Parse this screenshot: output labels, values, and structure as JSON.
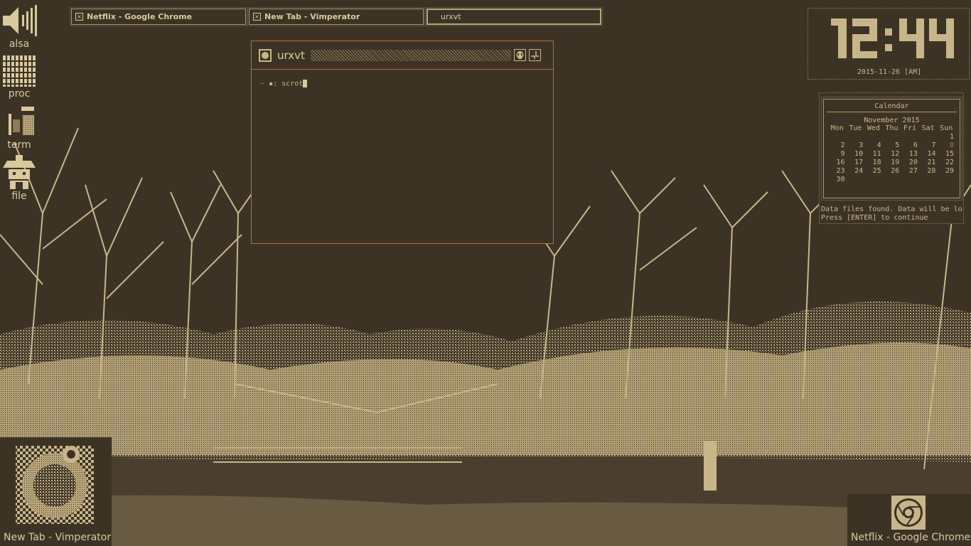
{
  "taskbar": {
    "tasks": [
      {
        "label": "Netflix - Google Chrome",
        "icon": "window-x-icon"
      },
      {
        "label": "New Tab - Vimperator",
        "icon": "window-x-icon"
      },
      {
        "label": "urxvt",
        "active": true
      }
    ]
  },
  "dock": {
    "items": [
      {
        "label": "alsa",
        "icon": "speaker-icon"
      },
      {
        "label": "proc",
        "icon": "process-grid-icon"
      },
      {
        "label": "term",
        "icon": "terminal-icon"
      },
      {
        "label": "file",
        "icon": "file-manager-icon"
      }
    ]
  },
  "terminal": {
    "title": "urxvt",
    "prompt_path": "~",
    "prompt_symbol": "▪:",
    "command": "scrot"
  },
  "clock": {
    "time": "12:44",
    "date": "2015-11-26 [AM]"
  },
  "calendar": {
    "title": "Calendar",
    "month": "November 2015",
    "weekdays": [
      "Mon",
      "Tue",
      "Wed",
      "Thu",
      "Fri",
      "Sat",
      "Sun"
    ],
    "weeks": [
      [
        "",
        "",
        "",
        "",
        "",
        "",
        "1"
      ],
      [
        "2",
        "3",
        "4",
        "5",
        "6",
        "7",
        "8"
      ],
      [
        "9",
        "10",
        "11",
        "12",
        "13",
        "14",
        "15"
      ],
      [
        "16",
        "17",
        "18",
        "19",
        "20",
        "21",
        "22"
      ],
      [
        "23",
        "24",
        "25",
        "26",
        "27",
        "28",
        "29"
      ],
      [
        "30",
        "",
        "",
        "",
        "",
        "",
        ""
      ]
    ],
    "highlighted_day": "8",
    "message_line1": "Data files found. Data will be lo",
    "message_line2": "Press [ENTER] to continue"
  },
  "bottom": {
    "left_window_label": "New Tab - Vimperator",
    "right_window_label": "Netflix - Google Chrome"
  },
  "colors": {
    "background": "#3d3325",
    "foreground": "#c8b68a",
    "accent": "#b0703a"
  }
}
